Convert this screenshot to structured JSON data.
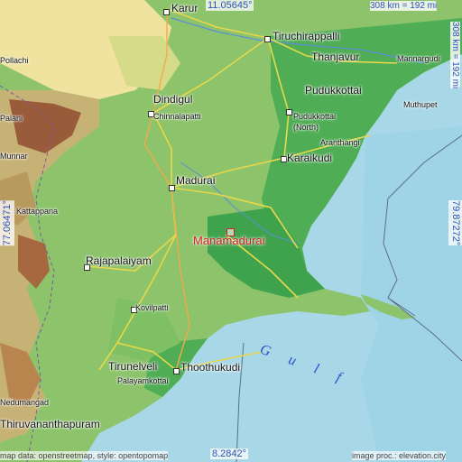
{
  "map": {
    "target": "Manamadurai",
    "colors": {
      "sea": "#a8d8e8",
      "lowland": "#3fa34d",
      "plain": "#8cc36b",
      "highland": "#f0e3a0",
      "mountain": "#9a5b3a",
      "road": "#e8d84a",
      "target": "#d42020"
    },
    "coords": {
      "top": "11.05645°",
      "bottom": "8.2842°",
      "left": "77.06471°",
      "right": "79.87272°"
    },
    "scale": {
      "horizontal": "308 km = 192 mi",
      "vertical": "308 km = 192 mi"
    },
    "attribution_left": "map data: openstreetmap, style: opentopomap",
    "attribution_right": "image proc.: elevation.city",
    "sea_label": "Gulf",
    "cities": [
      {
        "name": "Karur"
      },
      {
        "name": "Tiruchirappalli"
      },
      {
        "name": "Thanjavur"
      },
      {
        "name": "Mannargudi"
      },
      {
        "name": "Dindigul"
      },
      {
        "name": "Chinnalapatti"
      },
      {
        "name": "Pudukkottai"
      },
      {
        "name": "Pudukkottai"
      },
      {
        "name": "(North)"
      },
      {
        "name": "Muthupet"
      },
      {
        "name": "Aranthangi"
      },
      {
        "name": "Karaikudi"
      },
      {
        "name": "Madurai"
      },
      {
        "name": "Rajapalaiyam"
      },
      {
        "name": "Kovilpatti"
      },
      {
        "name": "Tirunelveli"
      },
      {
        "name": "Thoothukudi"
      },
      {
        "name": "Palayamkottai"
      },
      {
        "name": "Kattappana"
      },
      {
        "name": "Nedumangad"
      },
      {
        "name": "Thiruvananthapuram"
      },
      {
        "name": "Pollachi"
      },
      {
        "name": "Palani"
      },
      {
        "name": "Munnar"
      }
    ]
  }
}
